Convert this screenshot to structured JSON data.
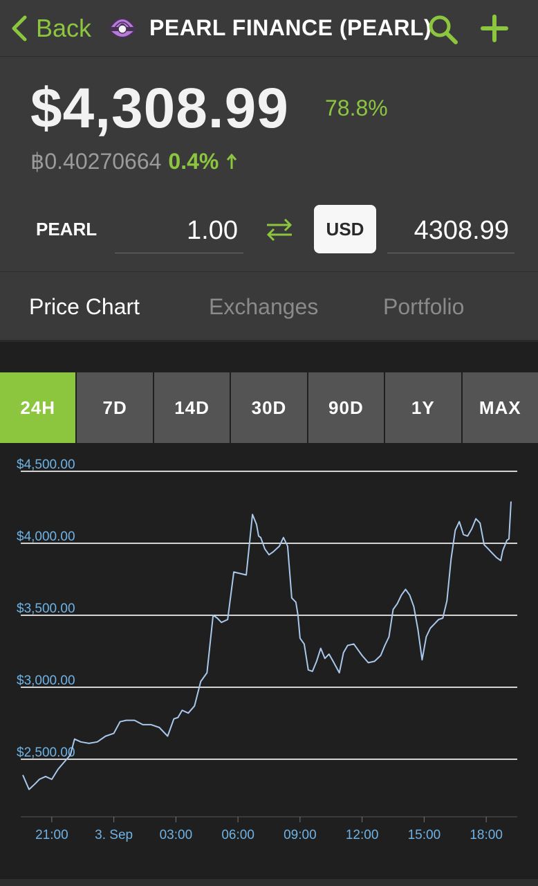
{
  "topbar": {
    "back_label": "Back",
    "title": "PEARL FINANCE (PEARL)",
    "accent": "#8cc63f",
    "icons": [
      "chevron-left-icon",
      "pearl-oyster-icon",
      "search-icon",
      "plus-icon"
    ]
  },
  "price": {
    "usd": "$4,308.99",
    "change": "78.8%",
    "btc": "฿0.40270664",
    "btc_change": "0.4%",
    "btc_direction": "up"
  },
  "converter": {
    "symbol": "PEARL",
    "amount": "1.00",
    "currency": "USD",
    "converted": "4308.99"
  },
  "tabs": [
    {
      "label": "Price Chart",
      "active": true
    },
    {
      "label": "Exchanges",
      "active": false
    },
    {
      "label": "Portfolio",
      "active": false
    }
  ],
  "ranges": [
    {
      "label": "24H",
      "active": true
    },
    {
      "label": "7D",
      "active": false
    },
    {
      "label": "14D",
      "active": false
    },
    {
      "label": "30D",
      "active": false
    },
    {
      "label": "90D",
      "active": false
    },
    {
      "label": "1Y",
      "active": false
    },
    {
      "label": "MAX",
      "active": false
    }
  ],
  "chart_data": {
    "type": "line",
    "title": "",
    "xlabel": "",
    "ylabel": "",
    "grid": true,
    "line_color": "#a9c8ec",
    "label_color": "#6fb3e6",
    "ylim": [
      2100,
      4600
    ],
    "xlim": [
      19.5,
      43.5
    ],
    "y_ticks": [
      {
        "value": 2500,
        "label": "$2,500.00"
      },
      {
        "value": 3000,
        "label": "$3,000.00"
      },
      {
        "value": 3500,
        "label": "$3,500.00"
      },
      {
        "value": 4000,
        "label": "$4,000.00"
      },
      {
        "value": 4500,
        "label": "$4,500.00"
      }
    ],
    "x_ticks": [
      {
        "value": 21,
        "label": "21:00"
      },
      {
        "value": 24,
        "label": "3. Sep"
      },
      {
        "value": 27,
        "label": "03:00"
      },
      {
        "value": 30,
        "label": "06:00"
      },
      {
        "value": 33,
        "label": "09:00"
      },
      {
        "value": 36,
        "label": "12:00"
      },
      {
        "value": 39,
        "label": "15:00"
      },
      {
        "value": 42,
        "label": "18:00"
      }
    ],
    "series": [
      {
        "x": [
          19.6,
          19.9,
          20.2,
          20.4,
          20.7,
          21.0,
          21.3,
          21.6,
          21.9,
          22.1,
          22.4,
          22.8,
          23.2,
          23.6,
          24.0,
          24.3,
          24.6,
          25.0,
          25.4,
          25.8,
          26.2,
          26.6,
          26.9,
          27.1,
          27.3,
          27.6,
          27.9,
          28.2,
          28.5,
          28.8,
          29.0,
          29.2,
          29.5,
          29.8,
          30.1,
          30.4,
          30.7,
          30.9,
          31.0,
          31.1,
          31.3,
          31.5,
          31.7,
          32.0,
          32.2,
          32.4,
          32.6,
          32.8,
          32.9,
          33.0,
          33.2,
          33.4,
          33.6,
          33.8,
          34.0,
          34.2,
          34.4,
          34.6,
          34.9,
          35.1,
          35.3,
          35.6,
          35.8,
          36.0,
          36.3,
          36.6,
          36.9,
          37.1,
          37.3,
          37.5,
          37.7,
          37.9,
          38.1,
          38.3,
          38.5,
          38.7,
          38.9,
          39.1,
          39.3,
          39.5,
          39.7,
          39.9,
          40.1,
          40.3,
          40.5,
          40.7,
          40.9,
          41.1,
          41.3,
          41.5,
          41.7,
          41.9,
          42.1,
          42.3,
          42.5,
          42.7,
          42.8,
          43.0,
          43.1,
          43.2
        ],
        "values": [
          2390,
          2290,
          2330,
          2360,
          2380,
          2360,
          2430,
          2480,
          2530,
          2640,
          2620,
          2610,
          2620,
          2660,
          2680,
          2760,
          2770,
          2770,
          2740,
          2740,
          2720,
          2660,
          2780,
          2790,
          2840,
          2820,
          2870,
          3040,
          3100,
          3500,
          3480,
          3450,
          3470,
          3800,
          3790,
          3780,
          4200,
          4130,
          4050,
          4040,
          3960,
          3920,
          3940,
          3980,
          4040,
          3980,
          3620,
          3590,
          3500,
          3340,
          3300,
          3120,
          3110,
          3180,
          3270,
          3200,
          3230,
          3180,
          3100,
          3240,
          3290,
          3300,
          3260,
          3220,
          3170,
          3180,
          3220,
          3290,
          3350,
          3540,
          3580,
          3640,
          3680,
          3640,
          3560,
          3400,
          3190,
          3350,
          3410,
          3440,
          3470,
          3480,
          3600,
          3890,
          4090,
          4150,
          4060,
          4050,
          4100,
          4170,
          4140,
          3990,
          3960,
          3930,
          3900,
          3880,
          3950,
          4020,
          4030,
          4290
        ]
      }
    ]
  }
}
